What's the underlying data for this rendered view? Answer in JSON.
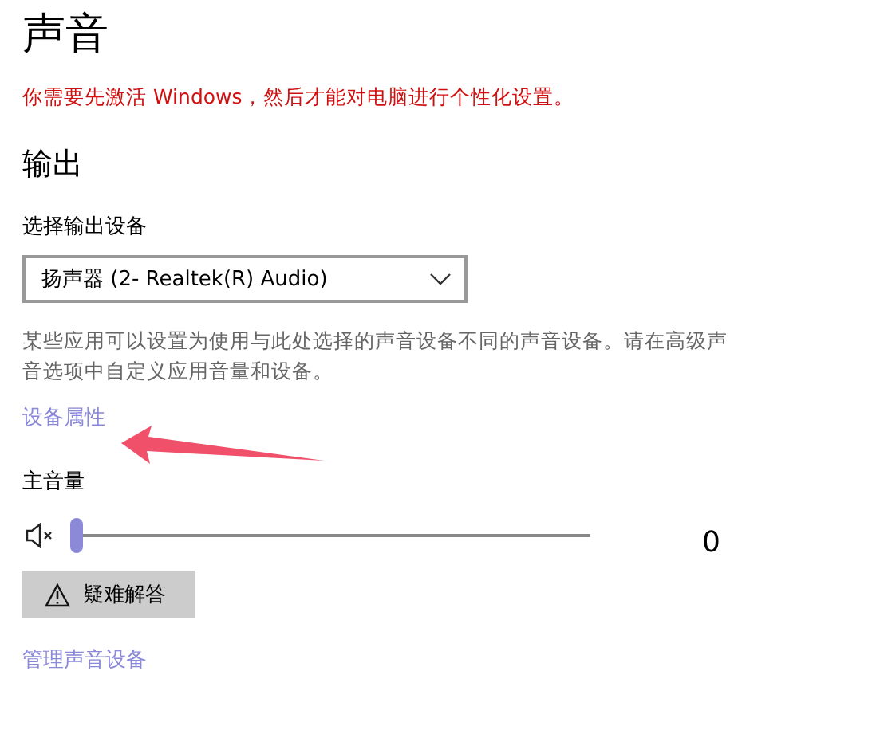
{
  "title": "声音",
  "activation_warning": "你需要先激活 Windows，然后才能对电脑进行个性化设置。",
  "section_title": "输出",
  "output_device": {
    "label": "选择输出设备",
    "value": "扬声器 (2- Realtek(R) Audio)"
  },
  "description": "某些应用可以设置为使用与此处选择的声音设备不同的声音设备。请在高级声音选项中自定义应用音量和设备。",
  "device_properties_link": "设备属性",
  "master_volume": {
    "label": "主音量",
    "muted": true,
    "level": 0,
    "reading": "0"
  },
  "troubleshoot_button": "疑难解答",
  "manage_devices_link": "管理声音设备"
}
